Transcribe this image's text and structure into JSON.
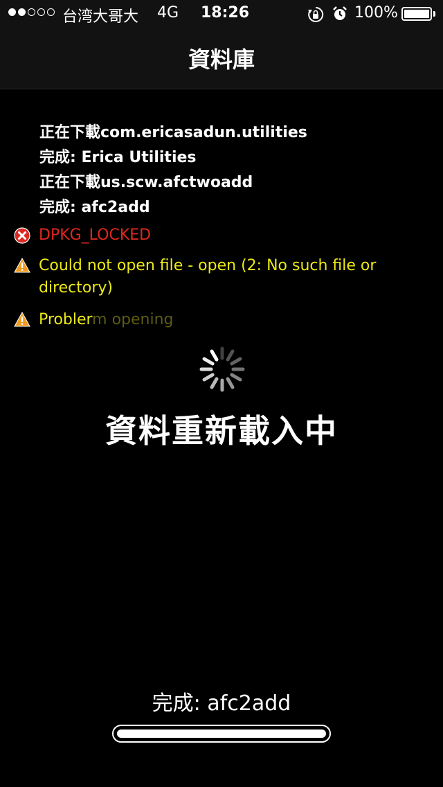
{
  "status_bar": {
    "signal_dots_filled": 2,
    "signal_dots_total": 5,
    "carrier": "台湾大哥大",
    "network": "4G",
    "time": "18:26",
    "icons": [
      "orientation-lock-icon",
      "alarm-icon",
      "battery-icon"
    ],
    "battery_percent": "100%",
    "battery_level": 1.0
  },
  "nav": {
    "title": "資料庫"
  },
  "log": {
    "lines": [
      "正在下載com.ericasadun.utilities",
      "完成: Erica Utilities",
      "正在下載us.scw.afctwoadd",
      "完成: afc2add"
    ],
    "error": {
      "icon": "error-x-icon",
      "text": "DPKG_LOCKED",
      "color": "#e0281e"
    },
    "warnings": [
      {
        "icon": "warning-icon",
        "text": "Could not open file - open (2: No such file or directory)",
        "color": "#ecea15"
      },
      {
        "icon": "warning-icon",
        "text_visible": "Probler",
        "text_faded": "m opening",
        "color": "#ecea15"
      }
    ]
  },
  "overlay": {
    "spinner_icon": "loading-spinner-icon",
    "title": "資料重新載入中",
    "status": "完成: afc2add",
    "progress": 1.0
  }
}
